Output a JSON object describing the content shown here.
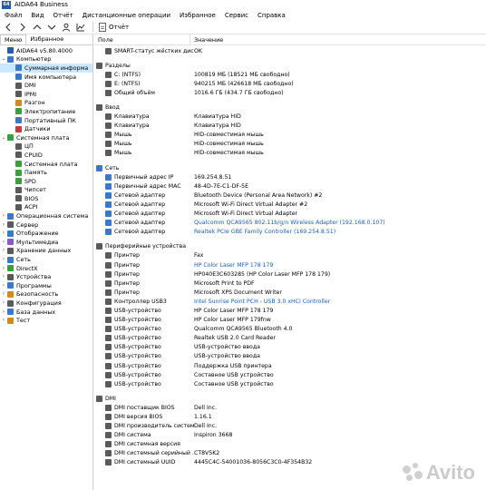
{
  "window": {
    "title": "AIDA64 Business",
    "app_icon_text": "64"
  },
  "menu": [
    "Файл",
    "Вид",
    "Отчёт",
    "Дистанционные операции",
    "Избранное",
    "Сервис",
    "Справка"
  ],
  "toolbar": {
    "report_label": "Отчёт"
  },
  "left_panel": {
    "tabs": [
      "Меню",
      "Избранное"
    ],
    "tree": [
      {
        "label": "AIDA64 v5.80.4000",
        "level": 0,
        "exp": "",
        "color": "#2c5aa0"
      },
      {
        "label": "Компьютер",
        "level": 0,
        "exp": "⌄",
        "color": "#3a78c8"
      },
      {
        "label": "Суммарная информа",
        "level": 1,
        "exp": "",
        "color": "#3a78c8",
        "selected": true
      },
      {
        "label": "Имя компьютера",
        "level": 1,
        "exp": "",
        "color": "#3a78c8"
      },
      {
        "label": "DMI",
        "level": 1,
        "exp": "",
        "color": "#5a5a5a"
      },
      {
        "label": "IPMI",
        "level": 1,
        "exp": "",
        "color": "#5a5a5a"
      },
      {
        "label": "Разгон",
        "level": 1,
        "exp": "",
        "color": "#d28a1a"
      },
      {
        "label": "Электропитание",
        "level": 1,
        "exp": "",
        "color": "#3aa13a"
      },
      {
        "label": "Портативный ПК",
        "level": 1,
        "exp": "",
        "color": "#3a78c8"
      },
      {
        "label": "Датчики",
        "level": 1,
        "exp": "",
        "color": "#c83a3a"
      },
      {
        "label": "Системная плата",
        "level": 0,
        "exp": "⌄",
        "color": "#3aa13a"
      },
      {
        "label": "ЦП",
        "level": 1,
        "exp": "",
        "color": "#5a5a5a"
      },
      {
        "label": "CPUID",
        "level": 1,
        "exp": "",
        "color": "#5a5a5a"
      },
      {
        "label": "Системная плата",
        "level": 1,
        "exp": "",
        "color": "#3aa13a"
      },
      {
        "label": "Память",
        "level": 1,
        "exp": "",
        "color": "#3aa13a"
      },
      {
        "label": "SPD",
        "level": 1,
        "exp": "",
        "color": "#3aa13a"
      },
      {
        "label": "Чипсет",
        "level": 1,
        "exp": "",
        "color": "#5a5a5a"
      },
      {
        "label": "BIOS",
        "level": 1,
        "exp": "",
        "color": "#5a5a5a"
      },
      {
        "label": "ACPI",
        "level": 1,
        "exp": "",
        "color": "#5a5a5a"
      },
      {
        "label": "Операционная система",
        "level": 0,
        "exp": "›",
        "color": "#3a78c8"
      },
      {
        "label": "Сервер",
        "level": 0,
        "exp": "›",
        "color": "#5a5a5a"
      },
      {
        "label": "Отображение",
        "level": 0,
        "exp": "›",
        "color": "#3a78c8"
      },
      {
        "label": "Мультимедиа",
        "level": 0,
        "exp": "›",
        "color": "#8a5ac8"
      },
      {
        "label": "Хранение данных",
        "level": 0,
        "exp": "›",
        "color": "#5a5a5a"
      },
      {
        "label": "Сеть",
        "level": 0,
        "exp": "›",
        "color": "#3a78c8"
      },
      {
        "label": "DirectX",
        "level": 0,
        "exp": "›",
        "color": "#3aa13a"
      },
      {
        "label": "Устройства",
        "level": 0,
        "exp": "›",
        "color": "#5a5a5a"
      },
      {
        "label": "Программы",
        "level": 0,
        "exp": "›",
        "color": "#3a78c8"
      },
      {
        "label": "Безопасность",
        "level": 0,
        "exp": "›",
        "color": "#d28a1a"
      },
      {
        "label": "Конфигурация",
        "level": 0,
        "exp": "›",
        "color": "#5a5a5a"
      },
      {
        "label": "База данных",
        "level": 0,
        "exp": "›",
        "color": "#3a78c8"
      },
      {
        "label": "Тест",
        "level": 0,
        "exp": "›",
        "color": "#d28a1a"
      }
    ]
  },
  "right_panel": {
    "columns": {
      "field": "Поле",
      "value": "Значение"
    },
    "rows": [
      {
        "type": "item",
        "field": "SMART-статус жёстких дис...",
        "value": "OK",
        "color": "#5a5a5a"
      },
      {
        "type": "blank"
      },
      {
        "type": "section",
        "field": "Разделы",
        "color": "#5a5a5a"
      },
      {
        "type": "item",
        "field": "C: (NTFS)",
        "value": "100819 МБ (18521 МБ свободно)",
        "color": "#5a5a5a"
      },
      {
        "type": "item",
        "field": "E: (NTFS)",
        "value": "940215 МБ (426618 МБ свободно)",
        "color": "#5a5a5a"
      },
      {
        "type": "item",
        "field": "Общий объём",
        "value": "1016.6 ГБ (434.7 ГБ свободно)",
        "color": "#5a5a5a"
      },
      {
        "type": "blank"
      },
      {
        "type": "section",
        "field": "Ввод",
        "color": "#5a5a5a"
      },
      {
        "type": "item",
        "field": "Клавиатура",
        "value": "Клавиатура HID",
        "color": "#5a5a5a"
      },
      {
        "type": "item",
        "field": "Клавиатура",
        "value": "Клавиатура HID",
        "color": "#5a5a5a"
      },
      {
        "type": "item",
        "field": "Мышь",
        "value": "HID-совместимая мышь",
        "color": "#5a5a5a"
      },
      {
        "type": "item",
        "field": "Мышь",
        "value": "HID-совместимая мышь",
        "color": "#5a5a5a"
      },
      {
        "type": "item",
        "field": "Мышь",
        "value": "HID-совместимая мышь",
        "color": "#5a5a5a"
      },
      {
        "type": "blank"
      },
      {
        "type": "section",
        "field": "Сеть",
        "color": "#3a78c8"
      },
      {
        "type": "item",
        "field": "Первичный адрес IP",
        "value": "169.254.8.51",
        "color": "#3a78c8"
      },
      {
        "type": "item",
        "field": "Первичный адрес MAC",
        "value": "48-4D-7E-C1-DF-5E",
        "color": "#3a78c8"
      },
      {
        "type": "item",
        "field": "Сетевой адаптер",
        "value": "Bluetooth Device (Personal Area Network) #2",
        "color": "#3a78c8"
      },
      {
        "type": "item",
        "field": "Сетевой адаптер",
        "value": "Microsoft Wi-Fi Direct Virtual Adapter #2",
        "color": "#3a78c8"
      },
      {
        "type": "item",
        "field": "Сетевой адаптер",
        "value": "Microsoft Wi-Fi Direct Virtual Adapter",
        "color": "#3a78c8"
      },
      {
        "type": "item",
        "field": "Сетевой адаптер",
        "value": "Qualcomm QCA9565 802.11b/g/n Wireless Adapter  (192.168.0.107)",
        "color": "#3a78c8",
        "link": true
      },
      {
        "type": "item",
        "field": "Сетевой адаптер",
        "value": "Realtek PCIe GBE Family Controller  (169.254.8.51)",
        "color": "#3a78c8",
        "link": true
      },
      {
        "type": "blank"
      },
      {
        "type": "section",
        "field": "Периферийные устройства",
        "color": "#5a5a5a"
      },
      {
        "type": "item",
        "field": "Принтер",
        "value": "Fax",
        "color": "#5a5a5a"
      },
      {
        "type": "item",
        "field": "Принтер",
        "value": "HP Color Laser MFP 178 179",
        "color": "#5a5a5a",
        "link": true
      },
      {
        "type": "item",
        "field": "Принтер",
        "value": "HP040E3C603285 (HP Color Laser MFP 178 179)",
        "color": "#5a5a5a"
      },
      {
        "type": "item",
        "field": "Принтер",
        "value": "Microsoft Print to PDF",
        "color": "#5a5a5a"
      },
      {
        "type": "item",
        "field": "Принтер",
        "value": "Microsoft XPS Document Writer",
        "color": "#5a5a5a"
      },
      {
        "type": "item",
        "field": "Контроллер USB3",
        "value": "Intel Sunrise Point PCH - USB 3.0 xHCI Controller",
        "color": "#5a5a5a",
        "link": true
      },
      {
        "type": "item",
        "field": "USB-устройство",
        "value": "HP Color Laser MFP 178 179",
        "color": "#5a5a5a"
      },
      {
        "type": "item",
        "field": "USB-устройство",
        "value": "HP Color Laser MFP 179fnw",
        "color": "#5a5a5a"
      },
      {
        "type": "item",
        "field": "USB-устройство",
        "value": "Qualcomm QCA9565 Bluetooth 4.0",
        "color": "#5a5a5a"
      },
      {
        "type": "item",
        "field": "USB-устройство",
        "value": "Realtek USB 2.0 Card Reader",
        "color": "#5a5a5a"
      },
      {
        "type": "item",
        "field": "USB-устройство",
        "value": "USB-устройство ввода",
        "color": "#5a5a5a"
      },
      {
        "type": "item",
        "field": "USB-устройство",
        "value": "USB-устройство ввода",
        "color": "#5a5a5a"
      },
      {
        "type": "item",
        "field": "USB-устройство",
        "value": "Поддержка USB принтера",
        "color": "#5a5a5a"
      },
      {
        "type": "item",
        "field": "USB-устройство",
        "value": "Составное USB устройство",
        "color": "#5a5a5a"
      },
      {
        "type": "item",
        "field": "USB-устройство",
        "value": "Составное USB устройство",
        "color": "#5a5a5a"
      },
      {
        "type": "blank"
      },
      {
        "type": "section",
        "field": "DMI",
        "color": "#5a5a5a"
      },
      {
        "type": "item",
        "field": "DMI поставщик BIOS",
        "value": "Dell Inc.",
        "color": "#5a5a5a"
      },
      {
        "type": "item",
        "field": "DMI версия BIOS",
        "value": "1.16.1",
        "color": "#5a5a5a"
      },
      {
        "type": "item",
        "field": "DMI производитель системы",
        "value": "Dell Inc.",
        "color": "#5a5a5a"
      },
      {
        "type": "item",
        "field": "DMI система",
        "value": "Inspiron 3668",
        "color": "#5a5a5a"
      },
      {
        "type": "item",
        "field": "DMI системная версия",
        "value": "",
        "color": "#5a5a5a"
      },
      {
        "type": "item",
        "field": "DMI системный серийный ...",
        "value": "CT8V5K2",
        "color": "#5a5a5a"
      },
      {
        "type": "item",
        "field": "DMI системный UUID",
        "value": "4445C4C-54001036-8056C3C0-4F354B32",
        "color": "#5a5a5a"
      }
    ]
  },
  "watermark": {
    "text": "Avito"
  }
}
